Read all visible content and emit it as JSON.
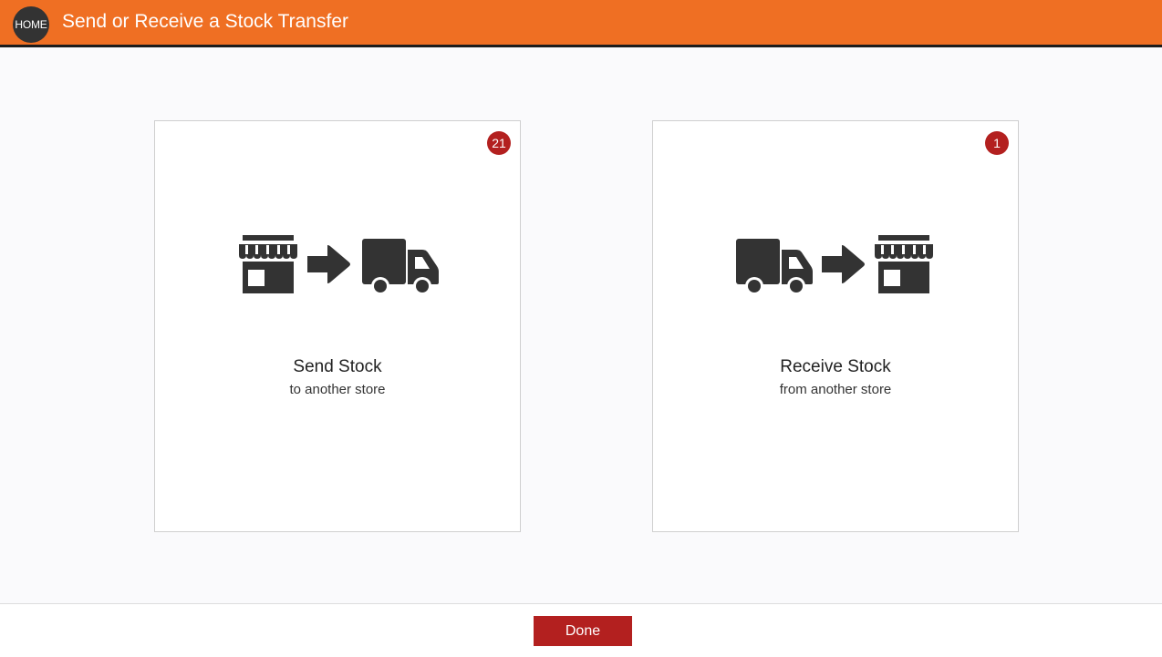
{
  "header": {
    "home_label": "HOME",
    "title": "Send or Receive a Stock Transfer",
    "background_color": "#ef6f23"
  },
  "cards": {
    "send": {
      "badge": "21",
      "title": "Send Stock",
      "subtitle": "to another store",
      "icons": [
        "store-icon",
        "arrow-right-icon",
        "truck-icon"
      ]
    },
    "receive": {
      "badge": "1",
      "title": "Receive Stock",
      "subtitle": "from another store",
      "icons": [
        "truck-icon",
        "arrow-right-icon",
        "store-icon"
      ]
    },
    "badge_color": "#b3201f"
  },
  "footer": {
    "done_label": "Done",
    "button_color": "#b3201f"
  }
}
